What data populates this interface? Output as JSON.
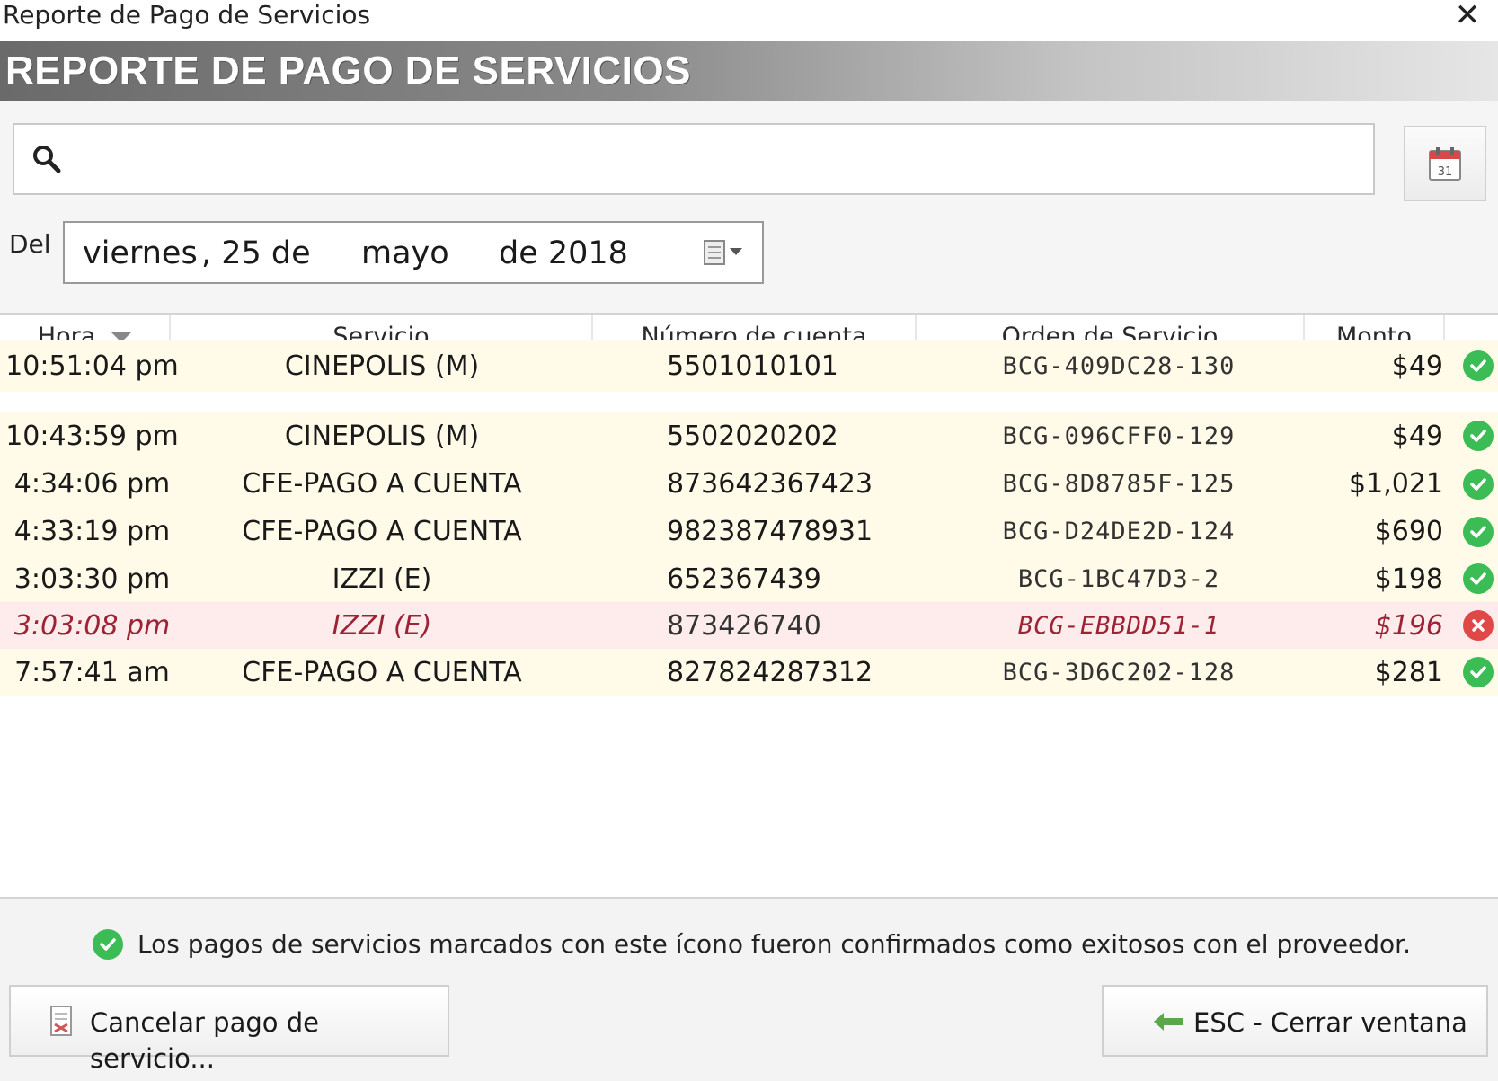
{
  "window": {
    "title": "Reporte de Pago de Servicios"
  },
  "banner": {
    "title": "REPORTE DE PAGO DE SERVICIOS"
  },
  "search": {
    "value": ""
  },
  "date_filter": {
    "label": "Del",
    "weekday": "viernes",
    "day_part": ", 25 de",
    "month": "mayo",
    "year_part": "de 2018"
  },
  "table": {
    "columns": [
      "Hora",
      "Servicio",
      "Número de cuenta",
      "Orden de Servicio",
      "Monto"
    ],
    "sort_column": "Hora",
    "rows": [
      {
        "hora": "10:51:04 pm",
        "servicio": "CINEPOLIS (M)",
        "cuenta": "5501010101",
        "orden": "BCG-409DC28-130",
        "monto": "$49",
        "status": "confirmed"
      },
      {
        "hora": "10:43:59 pm",
        "servicio": "CINEPOLIS (M)",
        "cuenta": "5502020202",
        "orden": "BCG-096CFF0-129",
        "monto": "$49",
        "status": "confirmed"
      },
      {
        "hora": "4:34:06 pm",
        "servicio": "CFE-PAGO A CUENTA",
        "cuenta": "873642367423",
        "orden": "BCG-8D8785F-125",
        "monto": "$1,021",
        "status": "confirmed"
      },
      {
        "hora": "4:33:19 pm",
        "servicio": "CFE-PAGO A CUENTA",
        "cuenta": "982387478931",
        "orden": "BCG-D24DE2D-124",
        "monto": "$690",
        "status": "confirmed"
      },
      {
        "hora": "3:03:30 pm",
        "servicio": "IZZI (E)",
        "cuenta": "652367439",
        "orden": "BCG-1BC47D3-2",
        "monto": "$198",
        "status": "confirmed"
      },
      {
        "hora": "3:03:08 pm",
        "servicio": "IZZI (E)",
        "cuenta": "873426740",
        "orden": "BCG-EBBDD51-1",
        "monto": "$196",
        "status": "cancelled"
      },
      {
        "hora": "7:57:41 am",
        "servicio": "CFE-PAGO A CUENTA",
        "cuenta": "827824287312",
        "orden": "BCG-3D6C202-128",
        "monto": "$281",
        "status": "confirmed"
      }
    ]
  },
  "footer": {
    "legend": "Los pagos de servicios marcados con este ícono fueron confirmados como exitosos con el proveedor.",
    "cancel_button": "Cancelar pago de servicio...",
    "close_button": "ESC - Cerrar ventana"
  },
  "colors": {
    "confirmed": "#3cbc55",
    "cancelled": "#e04848",
    "row_bg": "#fffbe8",
    "cancelled_row_bg": "#fdeceb",
    "cancelled_text": "#9b2335"
  },
  "icons": {
    "search": "search-icon",
    "calendar": "calendar-icon",
    "confirmed": "check-circle-icon",
    "cancelled": "x-circle-icon",
    "cancel_payment": "document-icon",
    "close": "arrow-left-icon"
  }
}
